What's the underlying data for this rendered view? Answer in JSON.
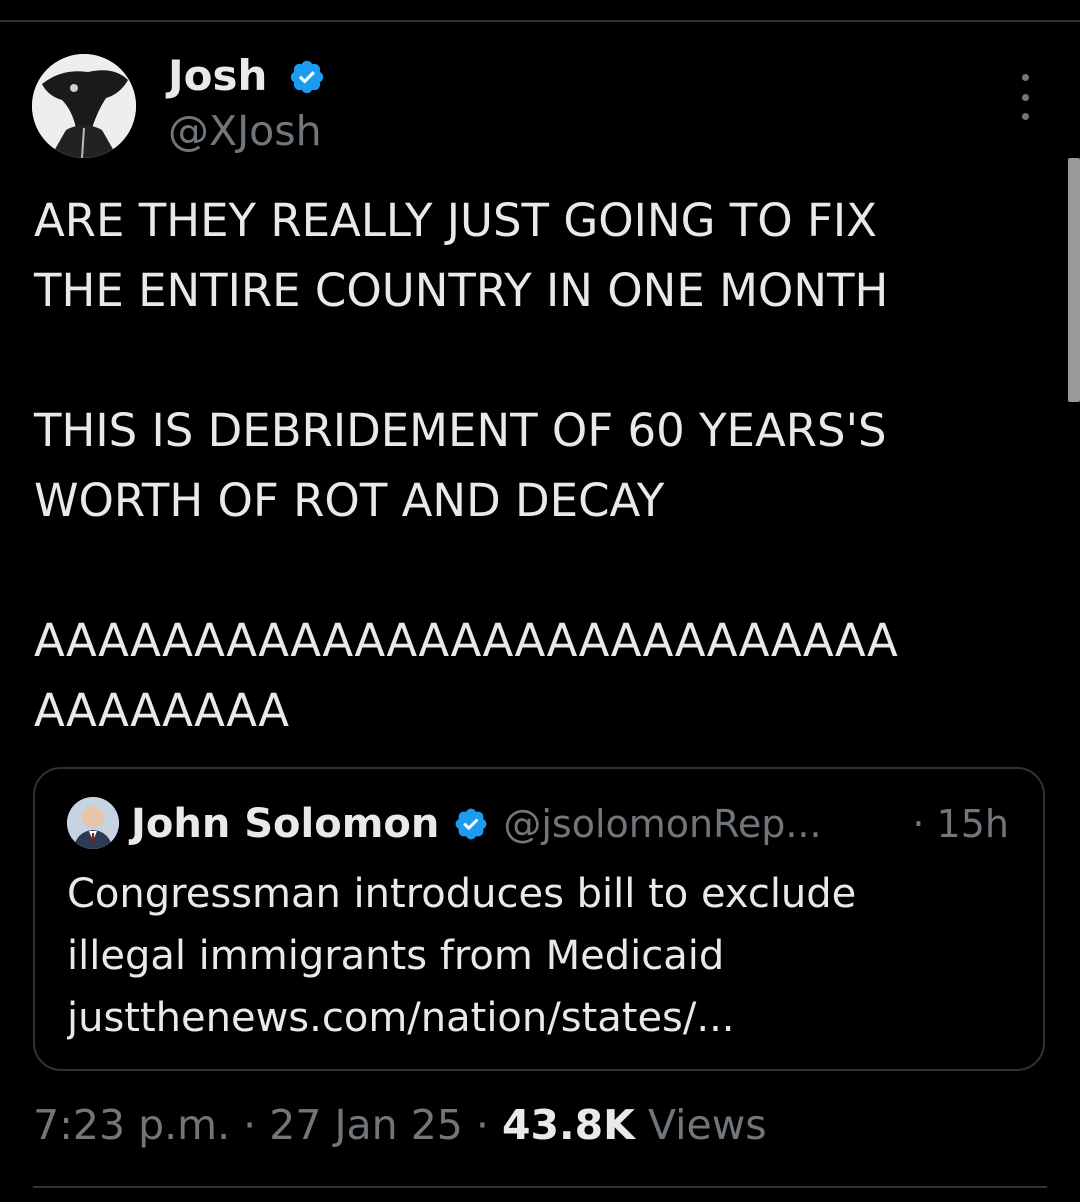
{
  "tweet": {
    "author": {
      "name": "Josh",
      "handle": "@XJosh",
      "verified": true
    },
    "paragraphs": [
      "ARE THEY REALLY JUST GOING TO FIX\nTHE ENTIRE COUNTRY IN ONE MONTH",
      "THIS IS DEBRIDEMENT OF 60 YEARS'S\nWORTH OF ROT AND DECAY",
      "AAAAAAAAAAAAAAAAAAAAAAAAAAA\nAAAAAAAA"
    ],
    "quote": {
      "name": "John Solomon",
      "handle": "@jsolomonRep...",
      "time": "· 15h",
      "verified": true,
      "text_lines": [
        "Congressman introduces bill to exclude",
        "illegal immigrants from Medicaid",
        "justthenews.com/nation/states/..."
      ]
    },
    "meta": {
      "time": "7:23 p.m.",
      "date": "27 Jan 25",
      "views_count": "43.8K",
      "views_label": "Views"
    }
  },
  "colors": {
    "background": "#000000",
    "text": "#e7e9ea",
    "secondary": "#71767b",
    "verified": "#1d9bf0",
    "border": "#2f3336"
  },
  "icons": {
    "verified": "verified-badge-icon",
    "more": "more-dots-vertical-icon"
  }
}
